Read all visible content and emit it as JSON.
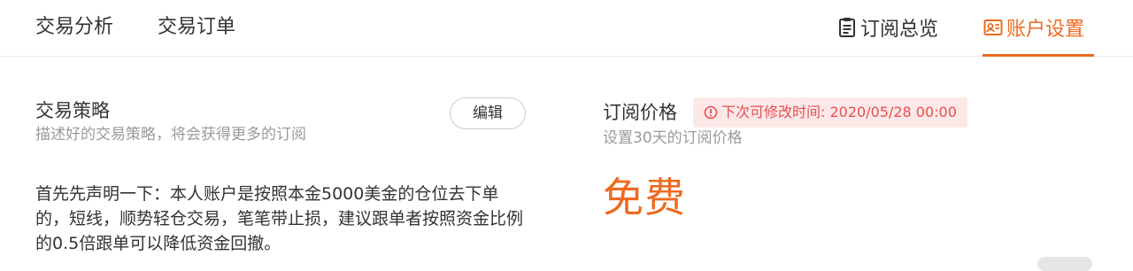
{
  "nav": {
    "tabs": [
      {
        "label": "交易分析"
      },
      {
        "label": "交易订单"
      }
    ],
    "right": [
      {
        "label": "订阅总览",
        "icon": "clipboard-icon"
      },
      {
        "label": "账户设置",
        "icon": "account-settings-icon",
        "active": true
      }
    ]
  },
  "strategy": {
    "title": "交易策略",
    "subtitle": "描述好的交易策略，将会获得更多的订阅",
    "edit_label": "编辑",
    "description": "首先先声明一下：本人账户是按照本金5000美金的仓位去下单的，短线，顺势轻仓交易，笔笔带止损，建议跟单者按照资金比例的0.5倍跟单可以降低资金回撤。"
  },
  "pricing": {
    "title": "订阅价格",
    "notice": "下次可修改时间: 2020/05/28 00:00",
    "notice_icon": "info-icon",
    "subtitle": "设置30天的订阅价格",
    "price": "免费"
  },
  "colors": {
    "accent": "#ee6a20",
    "notice_bg": "#fde8e8",
    "notice_text": "#e45050"
  }
}
